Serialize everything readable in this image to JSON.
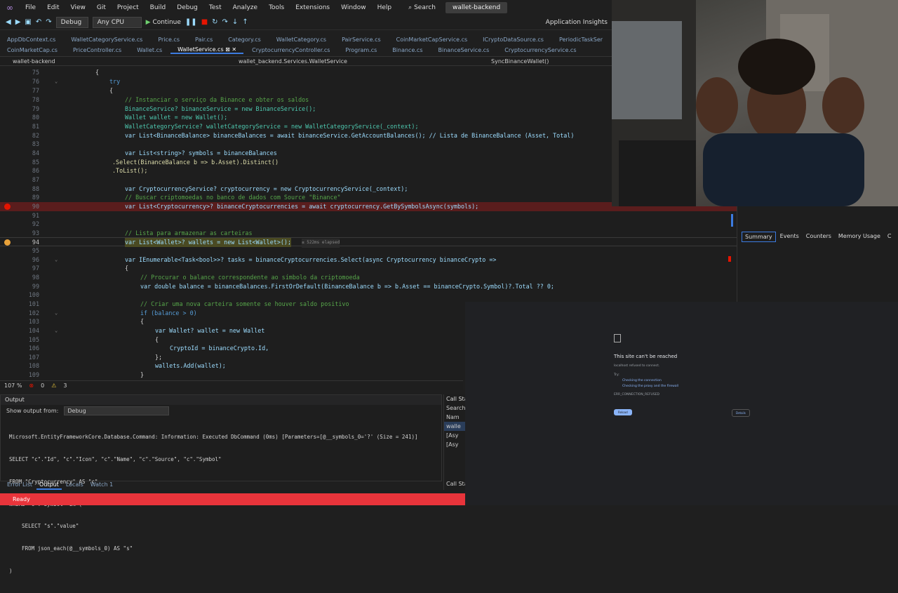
{
  "menubar": {
    "items": [
      "File",
      "Edit",
      "View",
      "Git",
      "Project",
      "Build",
      "Debug",
      "Test",
      "Analyze",
      "Tools",
      "Extensions",
      "Window",
      "Help"
    ],
    "search_label": "Search",
    "solution_name": "wallet-backend"
  },
  "toolbar": {
    "config": "Debug",
    "platform": "Any CPU",
    "continue_label": "Continue",
    "insights_label": "Application Insights"
  },
  "tabs_row1": [
    "AppDbContext.cs",
    "WalletCategoryService.cs",
    "Price.cs",
    "Pair.cs",
    "Category.cs",
    "WalletCategory.cs",
    "PairService.cs",
    "CoinMarketCapService.cs",
    "ICryptoDataSource.cs",
    "PeriodicTaskSer"
  ],
  "tabs_row2": [
    "CoinMarketCap.cs",
    "PriceController.cs",
    "Wallet.cs",
    "WalletService.cs",
    "CryptocurrencyController.cs",
    "Program.cs",
    "Binance.cs",
    "BinanceService.cs",
    "CryptocurrencyService.cs"
  ],
  "active_tab": "WalletService.cs",
  "navbar": {
    "project": "wallet-backend",
    "class": "wallet_backend.Services.WalletService",
    "method": "SyncBinanceWallet()"
  },
  "code_lines": [
    {
      "n": "75",
      "t": "{"
    },
    {
      "n": "76",
      "t": "try"
    },
    {
      "n": "77",
      "t": "{"
    },
    {
      "n": "78",
      "t": "// Instanciar o serviço da Binance e obter os saldos"
    },
    {
      "n": "79",
      "t": "BinanceService? binanceService = new BinanceService();"
    },
    {
      "n": "80",
      "t": "Wallet wallet = new Wallet();"
    },
    {
      "n": "81",
      "t": "WalletCategoryService? walletCategoryService = new WalletCategoryService(_context);"
    },
    {
      "n": "82",
      "t": "var List<BinanceBalance> binanceBalances = await binanceService.GetAccountBalances(); // Lista de BinanceBalance (Asset, Total)"
    },
    {
      "n": "83",
      "t": ""
    },
    {
      "n": "84",
      "t": "var List<string>? symbols = binanceBalances"
    },
    {
      "n": "85",
      "t": ".Select(BinanceBalance b => b.Asset).Distinct()"
    },
    {
      "n": "86",
      "t": ".ToList();"
    },
    {
      "n": "87",
      "t": ""
    },
    {
      "n": "88",
      "t": "var CryptocurrencyService? cryptocurrency = new CryptocurrencyService(_context);"
    },
    {
      "n": "89",
      "t": "// Buscar criptomoedas no banco de dados com Source \"Binance\""
    },
    {
      "n": "90",
      "t": "var List<Cryptocurrency>? binanceCryptocurrencies = await cryptocurrency.GetBySymbolsAsync(symbols);"
    },
    {
      "n": "91",
      "t": ""
    },
    {
      "n": "92",
      "t": ""
    },
    {
      "n": "93",
      "t": "// Lista para armazenar as carteiras"
    },
    {
      "n": "94",
      "t": "var List<Wallet>? wallets = new List<Wallet>();"
    },
    {
      "n": "95",
      "t": ""
    },
    {
      "n": "96",
      "t": "var IEnumerable<Task<bool>>? tasks = binanceCryptocurrencies.Select(async Cryptocurrency binanceCrypto =>"
    },
    {
      "n": "97",
      "t": "{"
    },
    {
      "n": "98",
      "t": "// Procurar o balance correspondente ao símbolo da criptomoeda"
    },
    {
      "n": "99",
      "t": "var double balance = binanceBalances.FirstOrDefault(BinanceBalance b => b.Asset == binanceCrypto.Symbol)?.Total ?? 0;"
    },
    {
      "n": "100",
      "t": ""
    },
    {
      "n": "101",
      "t": "// Criar uma nova carteira somente se houver saldo positivo"
    },
    {
      "n": "102",
      "t": "if (balance > 0)"
    },
    {
      "n": "103",
      "t": "{"
    },
    {
      "n": "104",
      "t": "var Wallet? wallet = new Wallet"
    },
    {
      "n": "105",
      "t": "{"
    },
    {
      "n": "106",
      "t": "CryptoId = binanceCrypto.Id,"
    },
    {
      "n": "107",
      "t": "};"
    },
    {
      "n": "108",
      "t": "wallets.Add(wallet);"
    },
    {
      "n": "109",
      "t": "}"
    }
  ],
  "elapsed_hint": "≤ 522ms elapsed",
  "editor_status": {
    "zoom": "107 %",
    "errors": "0",
    "warnings": "3"
  },
  "output": {
    "title": "Output",
    "source_label": "Show output from:",
    "source_value": "Debug",
    "lines": [
      "Microsoft.EntityFrameworkCore.Database.Command: Information: Executed DbCommand (0ms) [Parameters=[@__symbols_0='?' (Size = 241)]",
      "SELECT \"c\".\"Id\", \"c\".\"Icon\", \"c\".\"Name\", \"c\".\"Source\", \"c\".\"Symbol\"",
      "FROM \"Cryptocurrency\" AS \"c\"",
      "WHERE \"c\".\"Symbol\" IN (",
      "    SELECT \"s\".\"value\"",
      "    FROM json_each(@__symbols_0) AS \"s\"",
      ")"
    ]
  },
  "bottom_tabs": [
    "Error List",
    "Output",
    "Locals",
    "Watch 1"
  ],
  "callstack": {
    "title": "Call Stac",
    "search": "Search",
    "col": "Nam",
    "rows": [
      "walle",
      "[Asy",
      "[Asy"
    ],
    "footer": "Call Stac"
  },
  "status": "Ready",
  "diagnostics_tabs": [
    "Summary",
    "Events",
    "Counters",
    "Memory Usage",
    "C"
  ],
  "browser": {
    "title": "This site can't be reached",
    "line1": "localhost refused to connect.",
    "line2": "Try:",
    "link1": "Checking the connection",
    "link2": "Checking the proxy and the firewall",
    "code": "ERR_CONNECTION_REFUSED",
    "reload": "Reload",
    "details": "Details"
  },
  "colors": {
    "status_bar": "#e8343b",
    "breakpoint": "#e51400",
    "accent": "#3c7be0"
  }
}
